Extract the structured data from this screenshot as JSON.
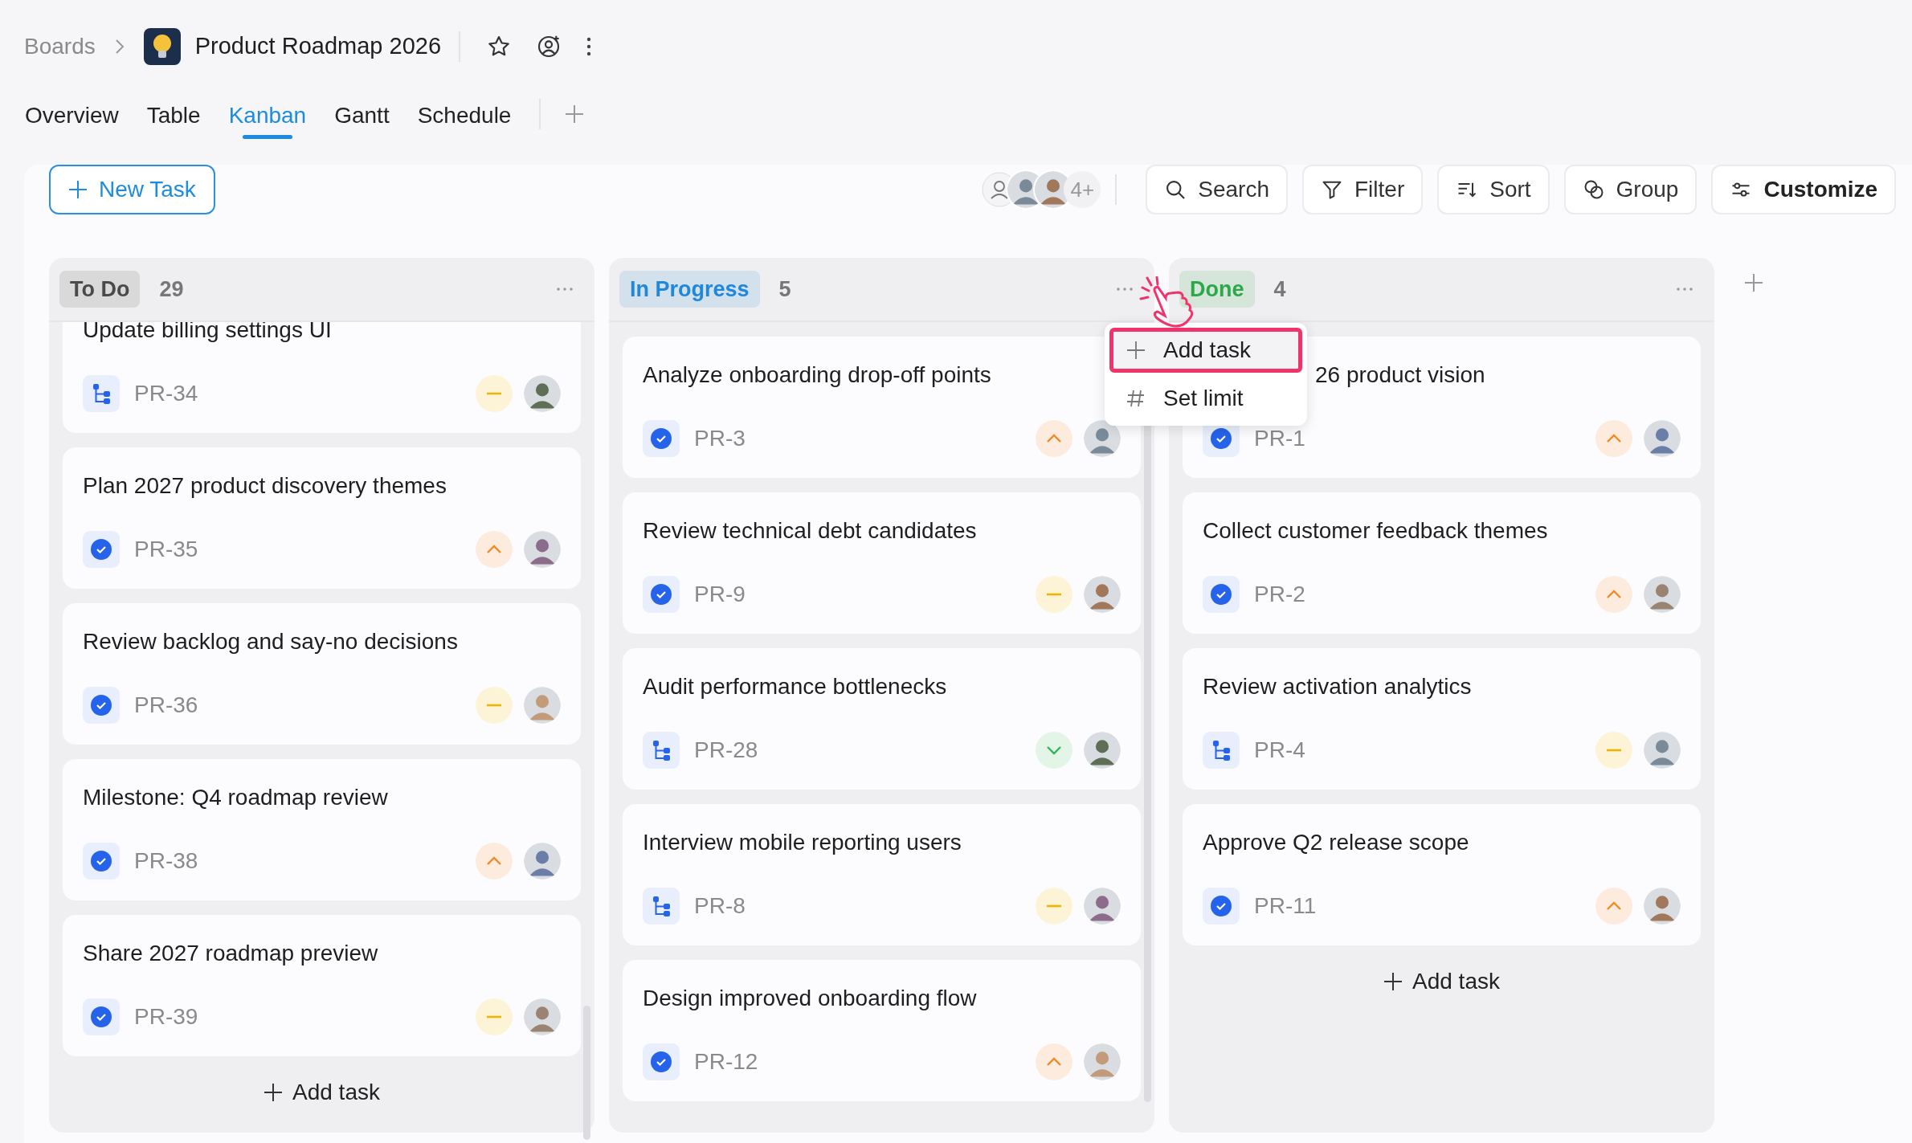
{
  "breadcrumb": {
    "parent": "Boards",
    "title": "Product Roadmap 2026"
  },
  "tabs": [
    {
      "label": "Overview",
      "selected": false
    },
    {
      "label": "Table",
      "selected": false
    },
    {
      "label": "Kanban",
      "selected": true
    },
    {
      "label": "Gantt",
      "selected": false
    },
    {
      "label": "Schedule",
      "selected": false
    }
  ],
  "toolbar": {
    "new_task": "New Task",
    "members_more": "4+",
    "buttons": [
      {
        "label": "Search",
        "primary": false
      },
      {
        "label": "Filter",
        "primary": false
      },
      {
        "label": "Sort",
        "primary": false
      },
      {
        "label": "Group",
        "primary": false
      },
      {
        "label": "Customize",
        "primary": true
      }
    ]
  },
  "columns": [
    {
      "title": "To Do",
      "count": "29",
      "color": "#4a4a4a",
      "add_task": "Add task",
      "scrolled": true,
      "cards": [
        {
          "title": "Update billing settings UI",
          "id": "PR-34",
          "type": {
            "kind": "subtask"
          },
          "priority": {
            "kind": "medium"
          },
          "under_menu": false
        },
        {
          "title": "Plan 2027 product discovery themes",
          "id": "PR-35",
          "type": {
            "kind": "task"
          },
          "priority": {
            "kind": "high"
          },
          "under_menu": false
        },
        {
          "title": "Review backlog and say-no decisions",
          "id": "PR-36",
          "type": {
            "kind": "task"
          },
          "priority": {
            "kind": "medium"
          },
          "under_menu": false
        },
        {
          "title": "Milestone: Q4 roadmap review",
          "id": "PR-38",
          "type": {
            "kind": "task"
          },
          "priority": {
            "kind": "high"
          },
          "under_menu": false
        },
        {
          "title": "Share 2027 roadmap preview",
          "id": "PR-39",
          "type": {
            "kind": "task"
          },
          "priority": {
            "kind": "medium"
          },
          "under_menu": false
        }
      ]
    },
    {
      "title": "In Progress",
      "count": "5",
      "color": "#1f87dc",
      "scrolled": false,
      "cards": [
        {
          "title": "Analyze onboarding drop-off points",
          "id": "PR-3",
          "type": {
            "kind": "task"
          },
          "priority": {
            "kind": "high"
          },
          "under_menu": false
        },
        {
          "title": "Review technical debt candidates",
          "id": "PR-9",
          "type": {
            "kind": "task"
          },
          "priority": {
            "kind": "medium"
          },
          "under_menu": false
        },
        {
          "title": "Audit performance bottlenecks",
          "id": "PR-28",
          "type": {
            "kind": "subtask"
          },
          "priority": {
            "kind": "low"
          },
          "under_menu": false
        },
        {
          "title": "Interview mobile reporting users",
          "id": "PR-8",
          "type": {
            "kind": "subtask"
          },
          "priority": {
            "kind": "medium"
          },
          "under_menu": false
        },
        {
          "title": "Design improved onboarding flow",
          "id": "PR-12",
          "type": {
            "kind": "task"
          },
          "priority": {
            "kind": "high"
          },
          "under_menu": false
        }
      ]
    },
    {
      "title": "Done",
      "count": "4",
      "color": "#2ba84a",
      "add_task": "Add task",
      "scrolled": false,
      "cards": [
        {
          "title": "26 product vision",
          "id": "PR-1",
          "type": {
            "kind": "task"
          },
          "priority": {
            "kind": "high"
          },
          "under_menu": true
        },
        {
          "title": "Collect customer feedback themes",
          "id": "PR-2",
          "type": {
            "kind": "task"
          },
          "priority": {
            "kind": "high"
          },
          "under_menu": false
        },
        {
          "title": "Review activation analytics",
          "id": "PR-4",
          "type": {
            "kind": "subtask"
          },
          "priority": {
            "kind": "medium"
          },
          "under_menu": false
        },
        {
          "title": "Approve Q2 release scope",
          "id": "PR-11",
          "type": {
            "kind": "task"
          },
          "priority": {
            "kind": "high"
          },
          "under_menu": false
        }
      ]
    }
  ],
  "column_menu": {
    "items": [
      {
        "label": "Add task",
        "selected": true,
        "kind": "add"
      },
      {
        "label": "Set limit",
        "selected": false,
        "kind": "limit"
      }
    ]
  }
}
